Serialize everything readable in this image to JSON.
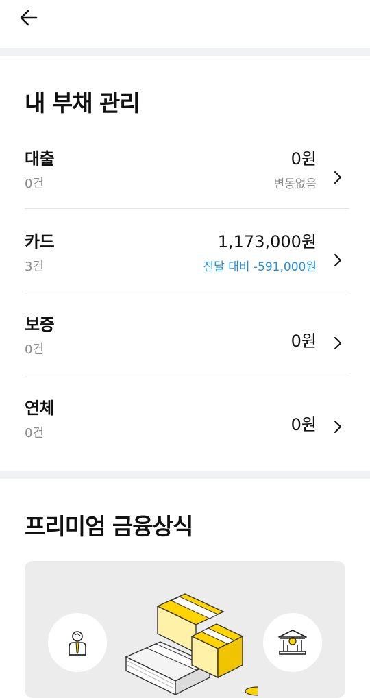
{
  "header": {
    "back_icon": "arrow-left-icon"
  },
  "debt": {
    "title": "내 부채 관리",
    "rows": [
      {
        "label": "대출",
        "count": "0건",
        "amount": "0원",
        "sub": "변동없음"
      },
      {
        "label": "카드",
        "count": "3건",
        "amount": "1,173,000원",
        "sub": "전달 대비 -591,000원"
      },
      {
        "label": "보증",
        "count": "0건",
        "amount": "0원"
      },
      {
        "label": "연체",
        "count": "0건",
        "amount": "0원"
      }
    ]
  },
  "premium": {
    "title": "프리미엄 금융상식"
  },
  "colors": {
    "accent_blue": "#1f8fe0",
    "muted_gray": "#8a8a8a",
    "coin_yellow": "#ffd400",
    "separator": "#f1f2f4"
  }
}
